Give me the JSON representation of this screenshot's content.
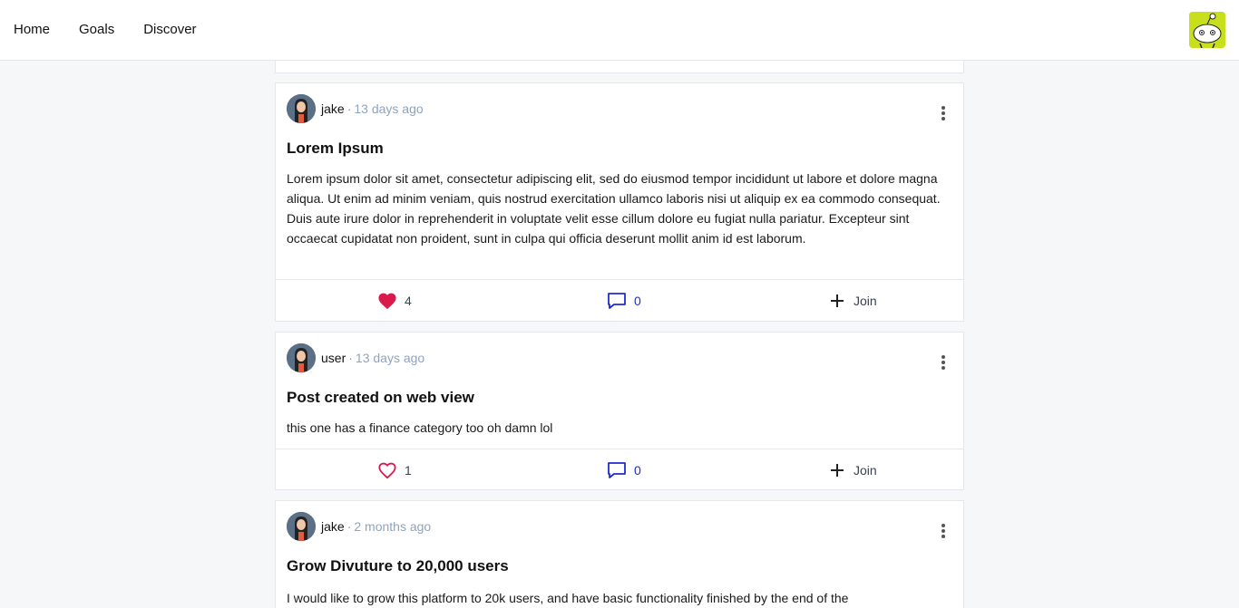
{
  "nav": {
    "items": [
      {
        "label": "Home"
      },
      {
        "label": "Goals"
      },
      {
        "label": "Discover"
      }
    ]
  },
  "colors": {
    "like_active": "#d81b4c",
    "like_outline": "#d81b4c",
    "comment": "#1e2bd1",
    "time": "#8fa3bf"
  },
  "posts": [
    {
      "author": "jake",
      "separator": "·",
      "time": "13 days ago",
      "title": "Lorem Ipsum",
      "body": "Lorem ipsum dolor sit amet, consectetur adipiscing elit, sed do eiusmod tempor incididunt ut labore et dolore magna aliqua. Ut enim ad minim veniam, quis nostrud exercitation ullamco laboris nisi ut aliquip ex ea commodo consequat. Duis aute irure dolor in reprehenderit in voluptate velit esse cillum dolore eu fugiat nulla pariatur. Excepteur sint occaecat cupidatat non proident, sunt in culpa qui officia deserunt mollit anim id est laborum.",
      "likes": "4",
      "liked": true,
      "comments": "0",
      "join_label": "Join"
    },
    {
      "author": "user",
      "separator": "·",
      "time": "13 days ago",
      "title": "Post created on web view",
      "body": "this one has a finance category too oh damn lol",
      "likes": "1",
      "liked": false,
      "comments": "0",
      "join_label": "Join"
    },
    {
      "author": "jake",
      "separator": "·",
      "time": "2 months ago",
      "title": "Grow Divuture to 20,000 users",
      "body": "I would like to grow this platform to 20k users, and have basic functionality finished by the end of the"
    }
  ]
}
